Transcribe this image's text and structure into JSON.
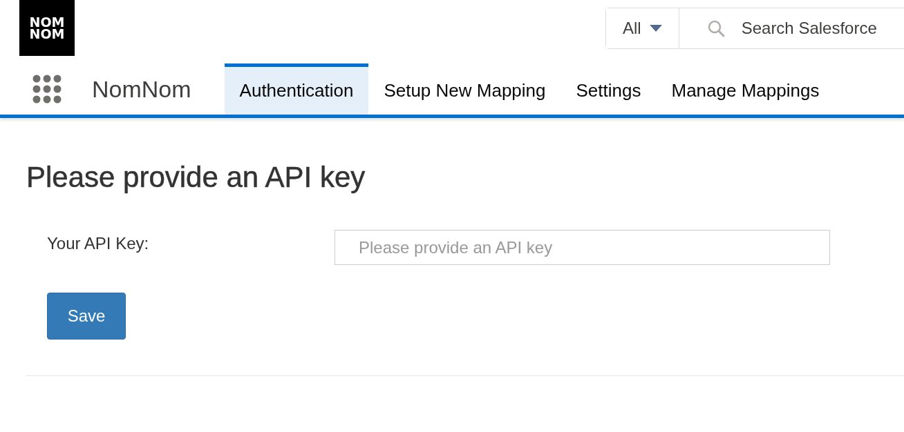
{
  "logo": {
    "lines": [
      "NOM",
      "NOM"
    ]
  },
  "search": {
    "scope": "All",
    "placeholder": "Search Salesforce"
  },
  "nav": {
    "app_name": "NomNom",
    "tabs": [
      {
        "label": "Authentication",
        "selected": true
      },
      {
        "label": "Setup New Mapping",
        "selected": false
      },
      {
        "label": "Settings",
        "selected": false
      },
      {
        "label": "Manage Mappings",
        "selected": false
      }
    ]
  },
  "page": {
    "heading": "Please provide an API key",
    "field_label": "Your API Key:",
    "field_placeholder": "Please provide an API key",
    "button": "Save"
  }
}
